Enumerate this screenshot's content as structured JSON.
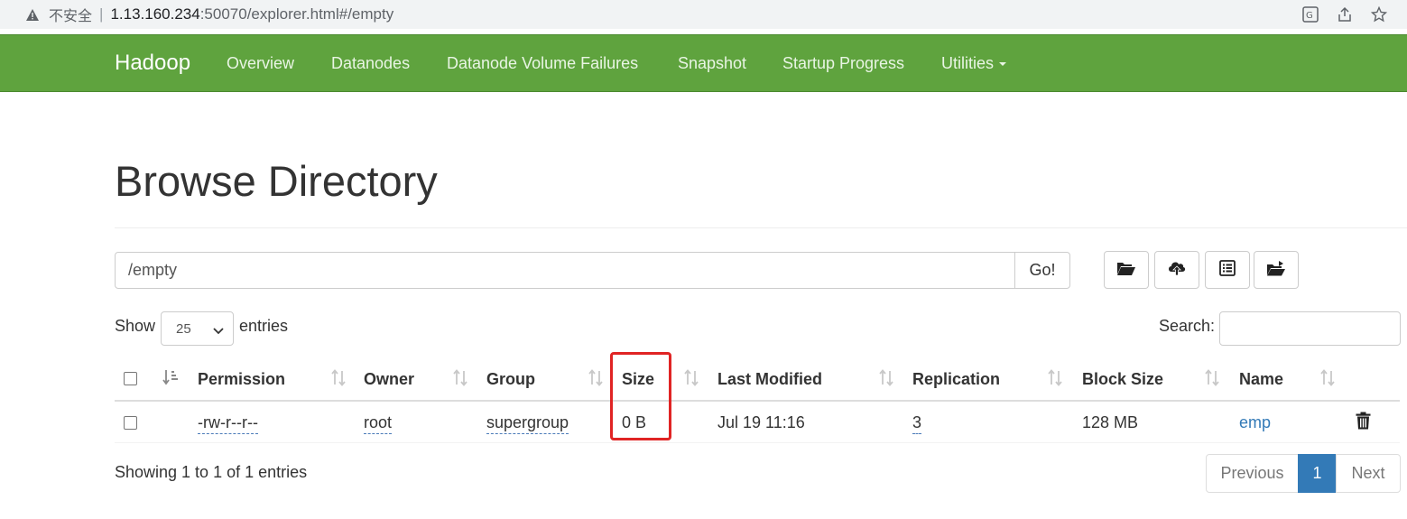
{
  "browser": {
    "security_label": "不安全",
    "separator": "|",
    "url_host": "1.13.160.234",
    "url_rest": ":50070/explorer.html#/empty"
  },
  "navbar": {
    "brand": "Hadoop",
    "items": [
      "Overview",
      "Datanodes",
      "Datanode Volume Failures",
      "Snapshot",
      "Startup Progress",
      "Utilities"
    ],
    "background_color": "#5fa33e"
  },
  "page": {
    "title": "Browse Directory",
    "path_value": "/empty",
    "go_label": "Go!",
    "toolbar_icons": [
      "folder-open-icon",
      "cloud-upload-icon",
      "list-icon",
      "folder-move-icon"
    ]
  },
  "length": {
    "show_label": "Show",
    "selected": "25",
    "entries_label": "entries"
  },
  "search": {
    "label": "Search:",
    "value": ""
  },
  "table": {
    "headers": [
      "Permission",
      "Owner",
      "Group",
      "Size",
      "Last Modified",
      "Replication",
      "Block Size",
      "Name"
    ],
    "rows": [
      {
        "permission": "-rw-r--r--",
        "owner": "root",
        "group": "supergroup",
        "size": "0 B",
        "last_modified": "Jul 19 11:16",
        "replication": "3",
        "block_size": "128 MB",
        "name": "emp"
      }
    ]
  },
  "info": "Showing 1 to 1 of 1 entries",
  "pagination": {
    "previous": "Previous",
    "current": "1",
    "next": "Next",
    "active_color": "#337ab7"
  },
  "annotation": {
    "highlight_color": "#e02424"
  }
}
